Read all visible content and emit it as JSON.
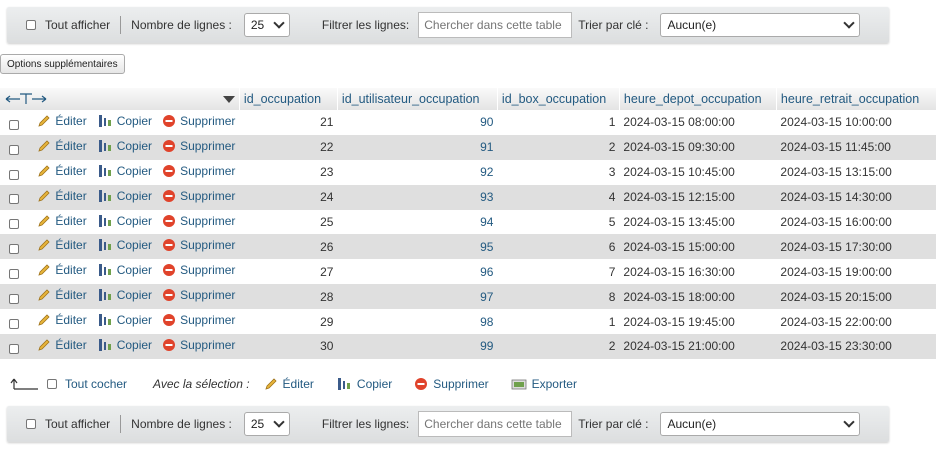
{
  "navbar": {
    "show_all": "Tout afficher",
    "rows_label": "Nombre de lignes :",
    "rows_value": "25",
    "filter_label": "Filtrer les lignes:",
    "filter_placeholder": "Chercher dans cette table",
    "sort_label": "Trier par clé :",
    "sort_value": "Aucun(e)"
  },
  "options_button": "Options supplémentaires",
  "table": {
    "columns": [
      "id_occupation",
      "id_utilisateur_occupation",
      "id_box_occupation",
      "heure_depot_occupation",
      "heure_retrait_occupation"
    ],
    "actions": {
      "edit": "Éditer",
      "copy": "Copier",
      "delete": "Supprimer"
    },
    "rows": [
      {
        "id": "21",
        "user": "90",
        "box": "1",
        "depot": "2024-03-15 08:00:00",
        "retrait": "2024-03-15 10:00:00"
      },
      {
        "id": "22",
        "user": "91",
        "box": "2",
        "depot": "2024-03-15 09:30:00",
        "retrait": "2024-03-15 11:45:00"
      },
      {
        "id": "23",
        "user": "92",
        "box": "3",
        "depot": "2024-03-15 10:45:00",
        "retrait": "2024-03-15 13:15:00"
      },
      {
        "id": "24",
        "user": "93",
        "box": "4",
        "depot": "2024-03-15 12:15:00",
        "retrait": "2024-03-15 14:30:00"
      },
      {
        "id": "25",
        "user": "94",
        "box": "5",
        "depot": "2024-03-15 13:45:00",
        "retrait": "2024-03-15 16:00:00"
      },
      {
        "id": "26",
        "user": "95",
        "box": "6",
        "depot": "2024-03-15 15:00:00",
        "retrait": "2024-03-15 17:30:00"
      },
      {
        "id": "27",
        "user": "96",
        "box": "7",
        "depot": "2024-03-15 16:30:00",
        "retrait": "2024-03-15 19:00:00"
      },
      {
        "id": "28",
        "user": "97",
        "box": "8",
        "depot": "2024-03-15 18:00:00",
        "retrait": "2024-03-15 20:15:00"
      },
      {
        "id": "29",
        "user": "98",
        "box": "1",
        "depot": "2024-03-15 19:45:00",
        "retrait": "2024-03-15 22:00:00"
      },
      {
        "id": "30",
        "user": "99",
        "box": "2",
        "depot": "2024-03-15 21:00:00",
        "retrait": "2024-03-15 23:30:00"
      }
    ]
  },
  "bulk": {
    "check_all": "Tout cocher",
    "with_selection": "Avec la sélection :",
    "edit": "Éditer",
    "copy": "Copier",
    "delete": "Supprimer",
    "export": "Exporter"
  },
  "colors": {
    "link": "#235a81",
    "row_alt": "#dfdfdf",
    "delete_icon": "#e0432b"
  }
}
